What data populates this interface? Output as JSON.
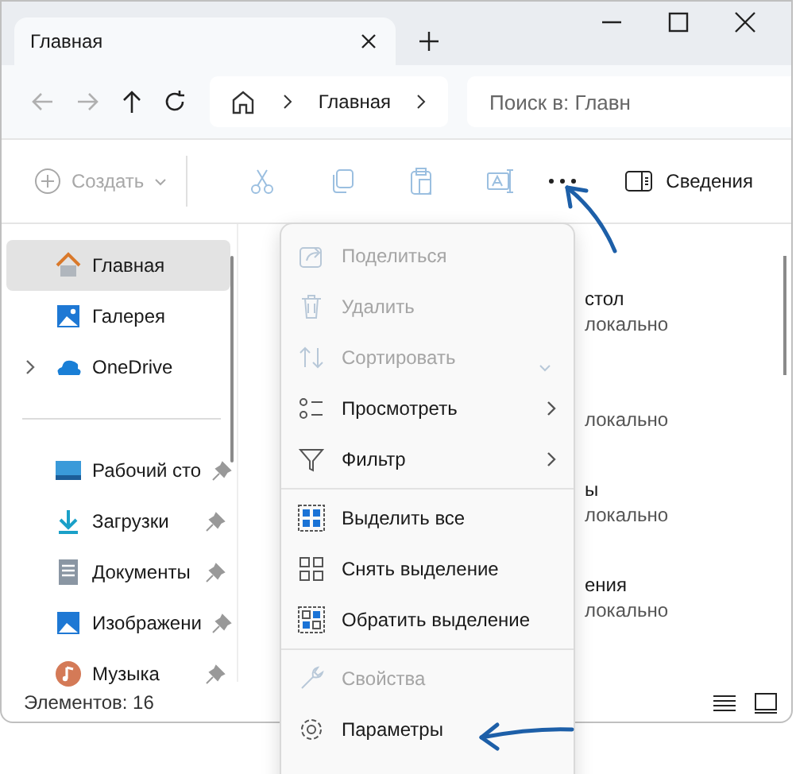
{
  "window": {
    "tab": {
      "title": "Главная"
    }
  },
  "nav": {
    "buttons": [
      {
        "disabled": true
      },
      {
        "disabled": true
      },
      {
        "disabled": false
      },
      {
        "disabled": false
      }
    ],
    "crumbs": [
      "Главная"
    ],
    "search": {
      "placeholder": "Поиск в: Главн"
    }
  },
  "toolbar": {
    "new": {
      "label": "Создать",
      "disabled": true
    },
    "actions": [
      {
        "disabled": true
      },
      {
        "disabled": true
      },
      {
        "disabled": true
      },
      {
        "disabled": true
      }
    ],
    "details": {
      "label": "Сведения"
    }
  },
  "sidebar": {
    "groups": [
      [
        {
          "label": "Главная",
          "selected": true,
          "pinned": false,
          "expandable": false
        },
        {
          "label": "Галерея",
          "selected": false,
          "pinned": false,
          "expandable": false
        },
        {
          "label": "OneDrive",
          "selected": false,
          "pinned": false,
          "expandable": true
        }
      ],
      [
        {
          "label": "Рабочий сто",
          "selected": false,
          "pinned": true,
          "expandable": false
        },
        {
          "label": "Загрузки",
          "selected": false,
          "pinned": true,
          "expandable": false
        },
        {
          "label": "Документы",
          "selected": false,
          "pinned": true,
          "expandable": false
        },
        {
          "label": "Изображени",
          "selected": false,
          "pinned": true,
          "expandable": false
        },
        {
          "label": "Музыка",
          "selected": false,
          "pinned": true,
          "expandable": false
        }
      ]
    ]
  },
  "content": {
    "rows": [
      {
        "title": "стол",
        "subtitle": "локально"
      },
      {
        "subtitle": "локально"
      },
      {
        "title": "ы",
        "subtitle": "локально"
      },
      {
        "title": "ения",
        "subtitle": "локально"
      }
    ]
  },
  "status_bar": {
    "count": "Элементов: 16"
  },
  "menu": {
    "groups": [
      [
        {
          "label": "Поделиться",
          "disabled": true
        },
        {
          "label": "Удалить",
          "disabled": true
        },
        {
          "label": "Сортировать",
          "disabled": true,
          "dropdown": true
        },
        {
          "label": "Просмотреть",
          "disabled": false,
          "submenu": true
        },
        {
          "label": "Фильтр",
          "disabled": false,
          "submenu": true
        }
      ],
      [
        {
          "label": "Выделить все",
          "disabled": false
        },
        {
          "label": "Снять выделение",
          "disabled": false
        },
        {
          "label": "Обратить выделение",
          "disabled": false
        }
      ],
      [
        {
          "label": "Свойства",
          "disabled": true
        },
        {
          "label": "Параметры",
          "disabled": false
        }
      ]
    ]
  }
}
